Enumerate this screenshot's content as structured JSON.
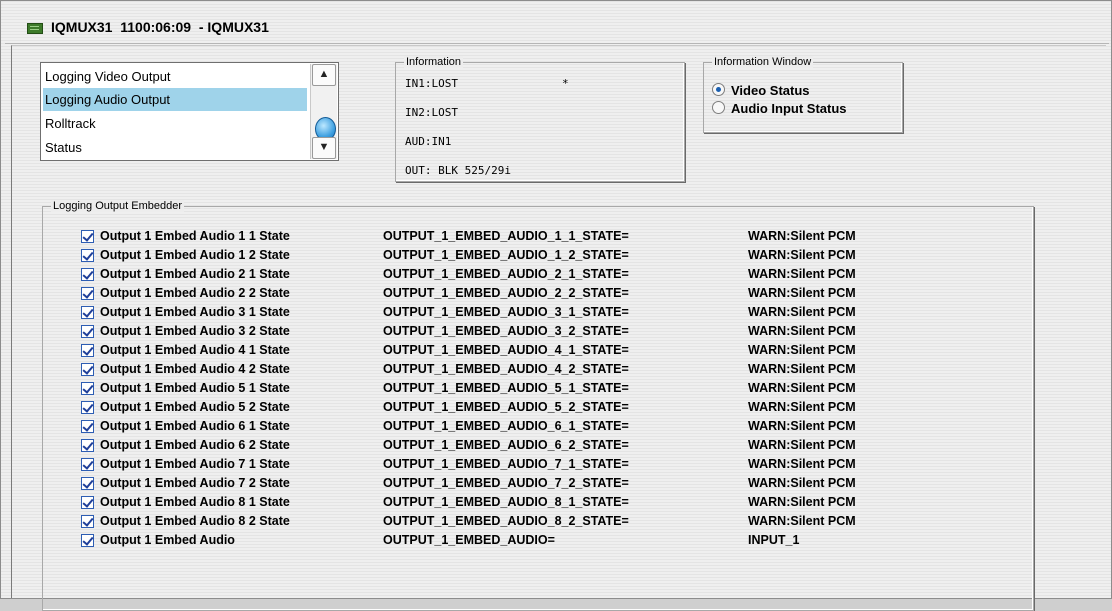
{
  "window": {
    "title": "IQMUX31  1100:06:09  - IQMUX31"
  },
  "listbox": {
    "items": [
      {
        "label": "Logging Video Output",
        "selected": false
      },
      {
        "label": "Logging Audio Output",
        "selected": true
      },
      {
        "label": "Rolltrack",
        "selected": false
      },
      {
        "label": "Status",
        "selected": false
      }
    ]
  },
  "information": {
    "legend": "Information",
    "lines": [
      "IN1:LOST",
      "IN2:LOST",
      "AUD:IN1",
      "OUT: BLK 525/29i"
    ],
    "marker": "*"
  },
  "information_window": {
    "legend": "Information Window",
    "options": [
      {
        "label": "Video Status",
        "checked": true
      },
      {
        "label": "Audio Input Status",
        "checked": false
      }
    ]
  },
  "logging": {
    "legend": "Logging Output Embedder",
    "rows": [
      {
        "label": "Output 1 Embed Audio 1 1 State",
        "key": "OUTPUT_1_EMBED_AUDIO_1_1_STATE=",
        "value": "WARN:Silent PCM",
        "checked": true
      },
      {
        "label": "Output 1 Embed Audio 1 2 State",
        "key": "OUTPUT_1_EMBED_AUDIO_1_2_STATE=",
        "value": "WARN:Silent PCM",
        "checked": true
      },
      {
        "label": "Output 1 Embed Audio 2 1 State",
        "key": "OUTPUT_1_EMBED_AUDIO_2_1_STATE=",
        "value": "WARN:Silent PCM",
        "checked": true
      },
      {
        "label": "Output 1 Embed Audio 2 2 State",
        "key": "OUTPUT_1_EMBED_AUDIO_2_2_STATE=",
        "value": "WARN:Silent PCM",
        "checked": true
      },
      {
        "label": "Output 1 Embed Audio 3 1 State",
        "key": "OUTPUT_1_EMBED_AUDIO_3_1_STATE=",
        "value": "WARN:Silent PCM",
        "checked": true
      },
      {
        "label": "Output 1 Embed Audio 3 2 State",
        "key": "OUTPUT_1_EMBED_AUDIO_3_2_STATE=",
        "value": "WARN:Silent PCM",
        "checked": true
      },
      {
        "label": "Output 1 Embed Audio 4 1 State",
        "key": "OUTPUT_1_EMBED_AUDIO_4_1_STATE=",
        "value": "WARN:Silent PCM",
        "checked": true
      },
      {
        "label": "Output 1 Embed Audio 4 2 State",
        "key": "OUTPUT_1_EMBED_AUDIO_4_2_STATE=",
        "value": "WARN:Silent PCM",
        "checked": true
      },
      {
        "label": "Output 1 Embed Audio 5 1 State",
        "key": "OUTPUT_1_EMBED_AUDIO_5_1_STATE=",
        "value": "WARN:Silent PCM",
        "checked": true
      },
      {
        "label": "Output 1 Embed Audio 5 2 State",
        "key": "OUTPUT_1_EMBED_AUDIO_5_2_STATE=",
        "value": "WARN:Silent PCM",
        "checked": true
      },
      {
        "label": "Output 1 Embed Audio 6 1 State",
        "key": "OUTPUT_1_EMBED_AUDIO_6_1_STATE=",
        "value": "WARN:Silent PCM",
        "checked": true
      },
      {
        "label": "Output 1 Embed Audio 6 2 State",
        "key": "OUTPUT_1_EMBED_AUDIO_6_2_STATE=",
        "value": "WARN:Silent PCM",
        "checked": true
      },
      {
        "label": "Output 1 Embed Audio 7 1 State",
        "key": "OUTPUT_1_EMBED_AUDIO_7_1_STATE=",
        "value": "WARN:Silent PCM",
        "checked": true
      },
      {
        "label": "Output 1 Embed Audio 7 2 State",
        "key": "OUTPUT_1_EMBED_AUDIO_7_2_STATE=",
        "value": "WARN:Silent PCM",
        "checked": true
      },
      {
        "label": "Output 1 Embed Audio 8 1 State",
        "key": "OUTPUT_1_EMBED_AUDIO_8_1_STATE=",
        "value": "WARN:Silent PCM",
        "checked": true
      },
      {
        "label": "Output 1 Embed Audio 8 2 State",
        "key": "OUTPUT_1_EMBED_AUDIO_8_2_STATE=",
        "value": "WARN:Silent PCM",
        "checked": true
      },
      {
        "label": "Output 1 Embed Audio",
        "key": "OUTPUT_1_EMBED_AUDIO=",
        "value": "INPUT_1",
        "checked": true
      }
    ]
  }
}
